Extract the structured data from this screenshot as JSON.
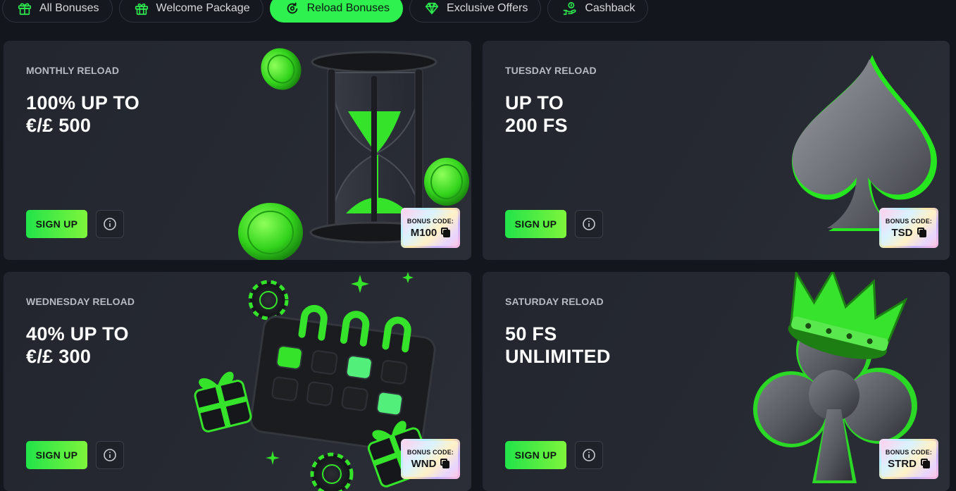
{
  "tabs": [
    {
      "label": "All Bonuses",
      "icon": "gift-icon",
      "active": false
    },
    {
      "label": "Welcome Package",
      "icon": "gift-box-icon",
      "active": false
    },
    {
      "label": "Reload Bonuses",
      "icon": "reload-icon",
      "active": true
    },
    {
      "label": "Exclusive Offers",
      "icon": "diamond-icon",
      "active": false
    },
    {
      "label": "Cashback",
      "icon": "cashback-hand-icon",
      "active": false
    }
  ],
  "cards": [
    {
      "kicker": "MONTHLY RELOAD",
      "line1": "100% UP TO",
      "line2": "€/£ 500",
      "signup": "SIGN UP",
      "code_label": "BONUS CODE:",
      "code": "M100",
      "art": "hourglass-with-green-coins"
    },
    {
      "kicker": "TUESDAY RELOAD",
      "line1": "UP TO",
      "line2": "200 FS",
      "signup": "SIGN UP",
      "code_label": "BONUS CODE:",
      "code": "TSD",
      "art": "spade-symbol"
    },
    {
      "kicker": "WEDNESDAY RELOAD",
      "line1": "40% UP TO",
      "line2": "€/£ 300",
      "signup": "SIGN UP",
      "code_label": "BONUS CODE:",
      "code": "WND",
      "art": "calendar-with-gifts-and-chips"
    },
    {
      "kicker": "SATURDAY RELOAD",
      "line1": "50 FS",
      "line2": "UNLIMITED",
      "signup": "SIGN UP",
      "code_label": "BONUS CODE:",
      "code": "STRD",
      "art": "club-symbol-with-crown"
    }
  ],
  "colors": {
    "accent": "#2ef04e",
    "background": "#13161c",
    "card": "#262932"
  }
}
